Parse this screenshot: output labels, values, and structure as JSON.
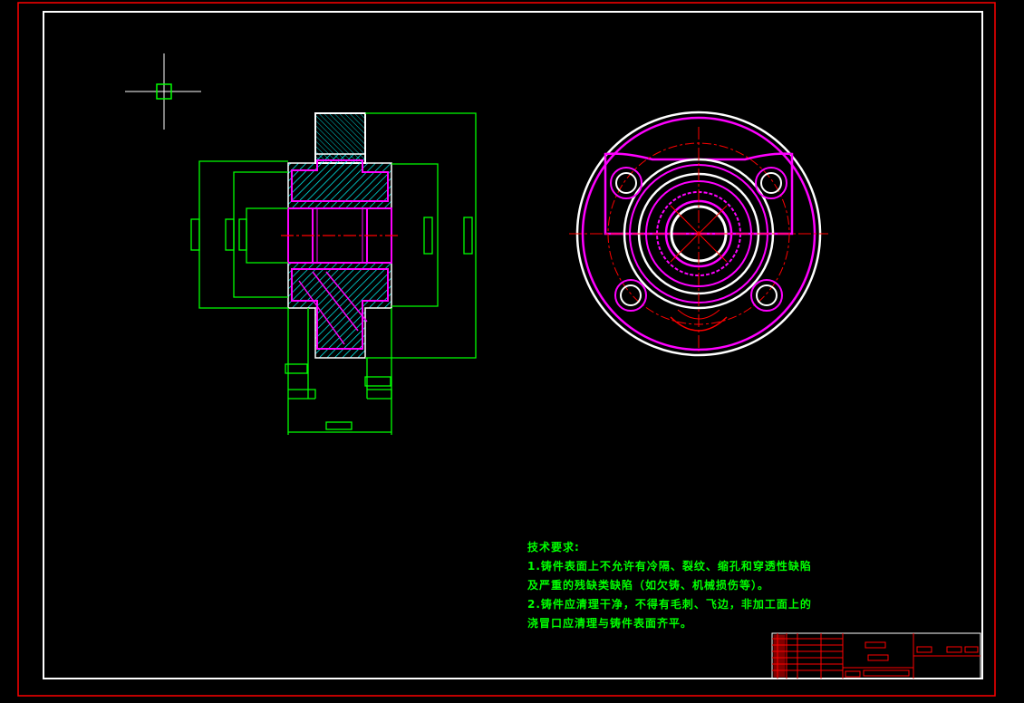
{
  "drawing": {
    "colors": {
      "background": "#000000",
      "sheet_border": "#ff0000",
      "frame": "#ffffff",
      "outline": "#00ff00",
      "hatch": "#00ffff",
      "hidden": "#ff00ff",
      "centerline": "#ff0000"
    }
  },
  "technical_requirements": {
    "heading": "技术要求:",
    "lines": [
      "1.铸件表面上不允许有冷隔、裂纹、缩孔和穿透性缺陷",
      "及严重的残缺类缺陷（如欠铸、机械损伤等）。",
      "2.铸件应清理干净，不得有毛刺、飞边，非加工面上的",
      "浇冒口应清理与铸件表面齐平。"
    ]
  },
  "title_block": {
    "present": true
  }
}
